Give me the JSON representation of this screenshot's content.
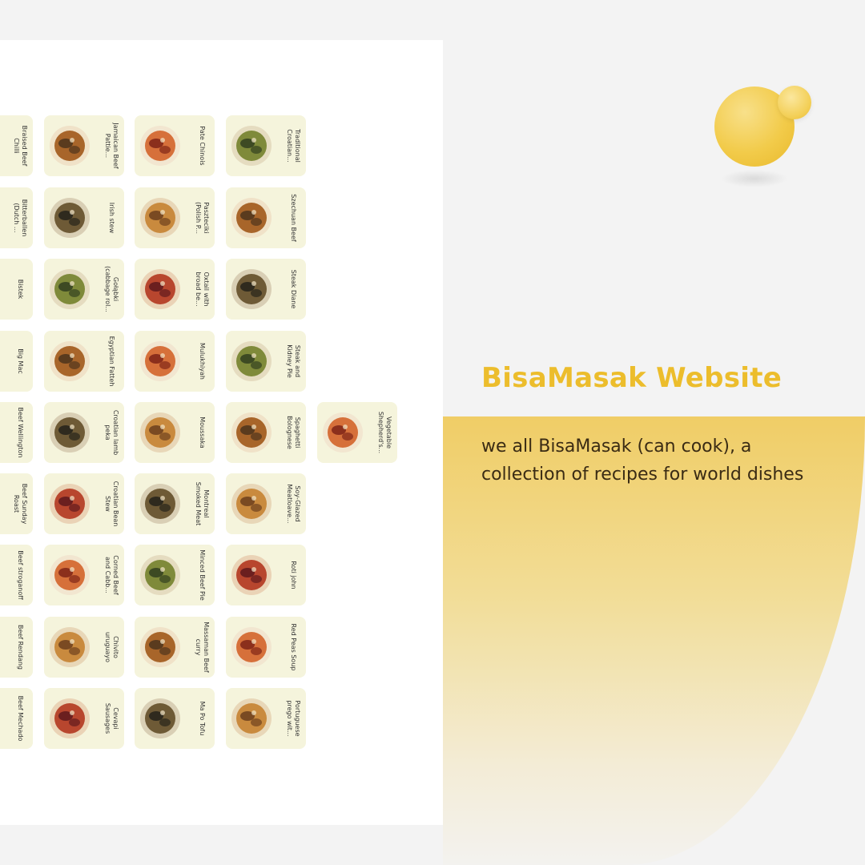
{
  "site": {
    "title": "BisaMasak Website",
    "description": "we all BisaMasak (can cook), a collection of recipes for world dishes"
  },
  "colors": {
    "accent": "#ecbd2c",
    "card_bg": "#f5f4dc",
    "panel_gradient_top": "#f0cd66",
    "text_dark": "#3a2b14"
  },
  "recipes": [
    {
      "name": "Braised Beef Chilli"
    },
    {
      "name": "Jamaican Beef Pattie..."
    },
    {
      "name": "Pate Chinois"
    },
    {
      "name": "Traditional Croatian..."
    },
    {
      "name": "Bitterballen (Dutch ..."
    },
    {
      "name": "Irish stew"
    },
    {
      "name": "Paszteciki (Polish P..."
    },
    {
      "name": "Szechuan Beef"
    },
    {
      "name": "Bistek"
    },
    {
      "name": "Gołąbki (cabbage rol..."
    },
    {
      "name": "Oxtail with broad be..."
    },
    {
      "name": "Steak Diane"
    },
    {
      "name": "Big Mac"
    },
    {
      "name": "Egyptian Fatteh"
    },
    {
      "name": "Mulukhiyah"
    },
    {
      "name": "Steak and Kidney Pie"
    },
    {
      "name": "Beef Wellington"
    },
    {
      "name": "Croatian lamb peka"
    },
    {
      "name": "Moussaka"
    },
    {
      "name": "Spaghetti Bolognese"
    },
    {
      "name": "Vegetable Shepherd's..."
    },
    {
      "name": "Beef Sunday Roast"
    },
    {
      "name": "Croatian Bean Stew"
    },
    {
      "name": "Montreal Smoked Meat"
    },
    {
      "name": "Soy-Glazed Meatloave..."
    },
    {
      "name": "Beef stroganoff"
    },
    {
      "name": "Corned Beef and Cabb..."
    },
    {
      "name": "Minced Beef Pie"
    },
    {
      "name": "Roti john"
    },
    {
      "name": "Beef Rendang"
    },
    {
      "name": "Chivito uruguayo"
    },
    {
      "name": "Massaman Beef curry"
    },
    {
      "name": "Red Peas Soup"
    },
    {
      "name": "Beef Mechado"
    },
    {
      "name": "Cevapi Sausages"
    },
    {
      "name": "Ma Po Tofu"
    },
    {
      "name": "Portuguese prego wit..."
    }
  ]
}
